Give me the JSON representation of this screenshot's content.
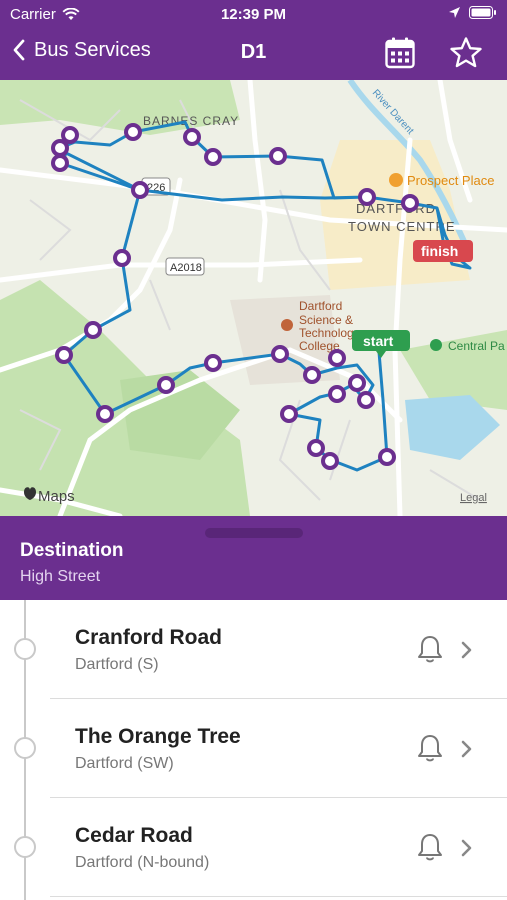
{
  "status_bar": {
    "carrier": "Carrier",
    "time": "12:39 PM"
  },
  "nav": {
    "back_label": "Bus Services",
    "title": "D1"
  },
  "colors": {
    "brand": "#6b2f8f",
    "route": "#1e82c0",
    "start": "#2e9e4f",
    "finish": "#d8484e"
  },
  "map": {
    "labels": {
      "area_barnes": "BARNES CRAY",
      "road_226": "226",
      "road_a2018": "A2018",
      "town_line1": "DARTFORD",
      "town_line2": "TOWN CENTRE",
      "prospect": "Prospect Place",
      "college_line1": "Dartford",
      "college_line2": "Science &",
      "college_line3": "Technology",
      "college_line4": "College",
      "central_park": "Central Pa",
      "river": "River Darent",
      "maps": "Maps",
      "legal": "Legal",
      "start": "start",
      "finish": "finish"
    }
  },
  "destination": {
    "title": "Destination",
    "value": "High Street"
  },
  "stops": [
    {
      "name": "Cranford Road",
      "area": "Dartford (S)"
    },
    {
      "name": "The Orange Tree",
      "area": "Dartford (SW)"
    },
    {
      "name": "Cedar Road",
      "area": "Dartford (N-bound)"
    }
  ]
}
